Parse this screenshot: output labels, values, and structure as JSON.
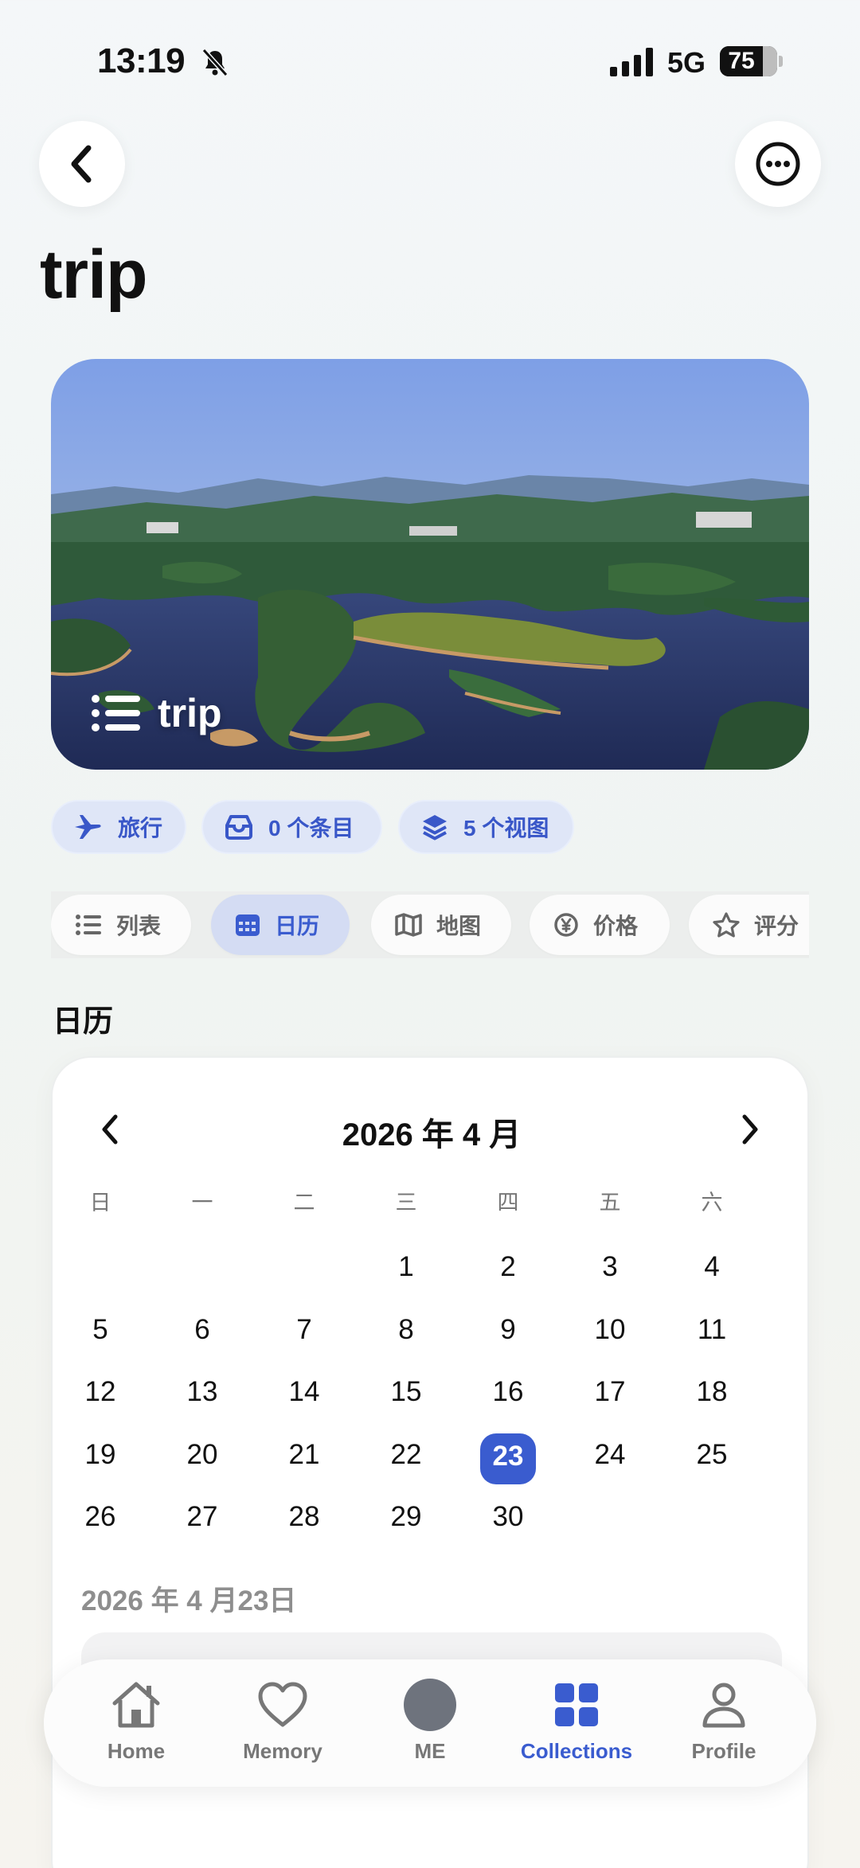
{
  "status_bar": {
    "time": "13:19",
    "network": "5G",
    "battery": "75",
    "battery_level": 0.75
  },
  "header": {
    "back_icon": "chevron-left-icon",
    "more_icon": "ellipsis-circle-icon",
    "title": "trip"
  },
  "hero": {
    "title": "trip",
    "icon": "list-icon"
  },
  "chips": [
    {
      "label": "旅行",
      "icon": "airplane-icon"
    },
    {
      "label": "0 个条目",
      "icon": "tray-icon"
    },
    {
      "label": "5 个视图",
      "icon": "layers-icon"
    }
  ],
  "view_tabs": [
    {
      "label": "列表",
      "icon": "list-icon",
      "active": false
    },
    {
      "label": "日历",
      "icon": "calendar-icon",
      "active": true
    },
    {
      "label": "地图",
      "icon": "map-icon",
      "active": false
    },
    {
      "label": "价格",
      "icon": "yen-icon",
      "active": false
    },
    {
      "label": "评分",
      "icon": "star-icon",
      "active": false
    }
  ],
  "section_title": "日历",
  "calendar": {
    "month_label": "2026 年 4 月",
    "weekdays": [
      "日",
      "一",
      "二",
      "三",
      "四",
      "五",
      "六"
    ],
    "first_weekday_index": 3,
    "days_in_month": 30,
    "selected_day": 23,
    "selected_date_label": "2026 年 4 月23日"
  },
  "bottom_nav": [
    {
      "label": "Home",
      "icon": "house-icon",
      "active": false
    },
    {
      "label": "Memory",
      "icon": "heart-icon",
      "active": false
    },
    {
      "label": "ME",
      "icon": "avatar-dot-icon",
      "active": false
    },
    {
      "label": "Collections",
      "icon": "grid-icon",
      "active": true
    },
    {
      "label": "Profile",
      "icon": "person-icon",
      "active": false
    }
  ],
  "colors": {
    "accent": "#3a5ccf",
    "chip_bg": "#dfe6f7",
    "text_muted": "#777777"
  }
}
